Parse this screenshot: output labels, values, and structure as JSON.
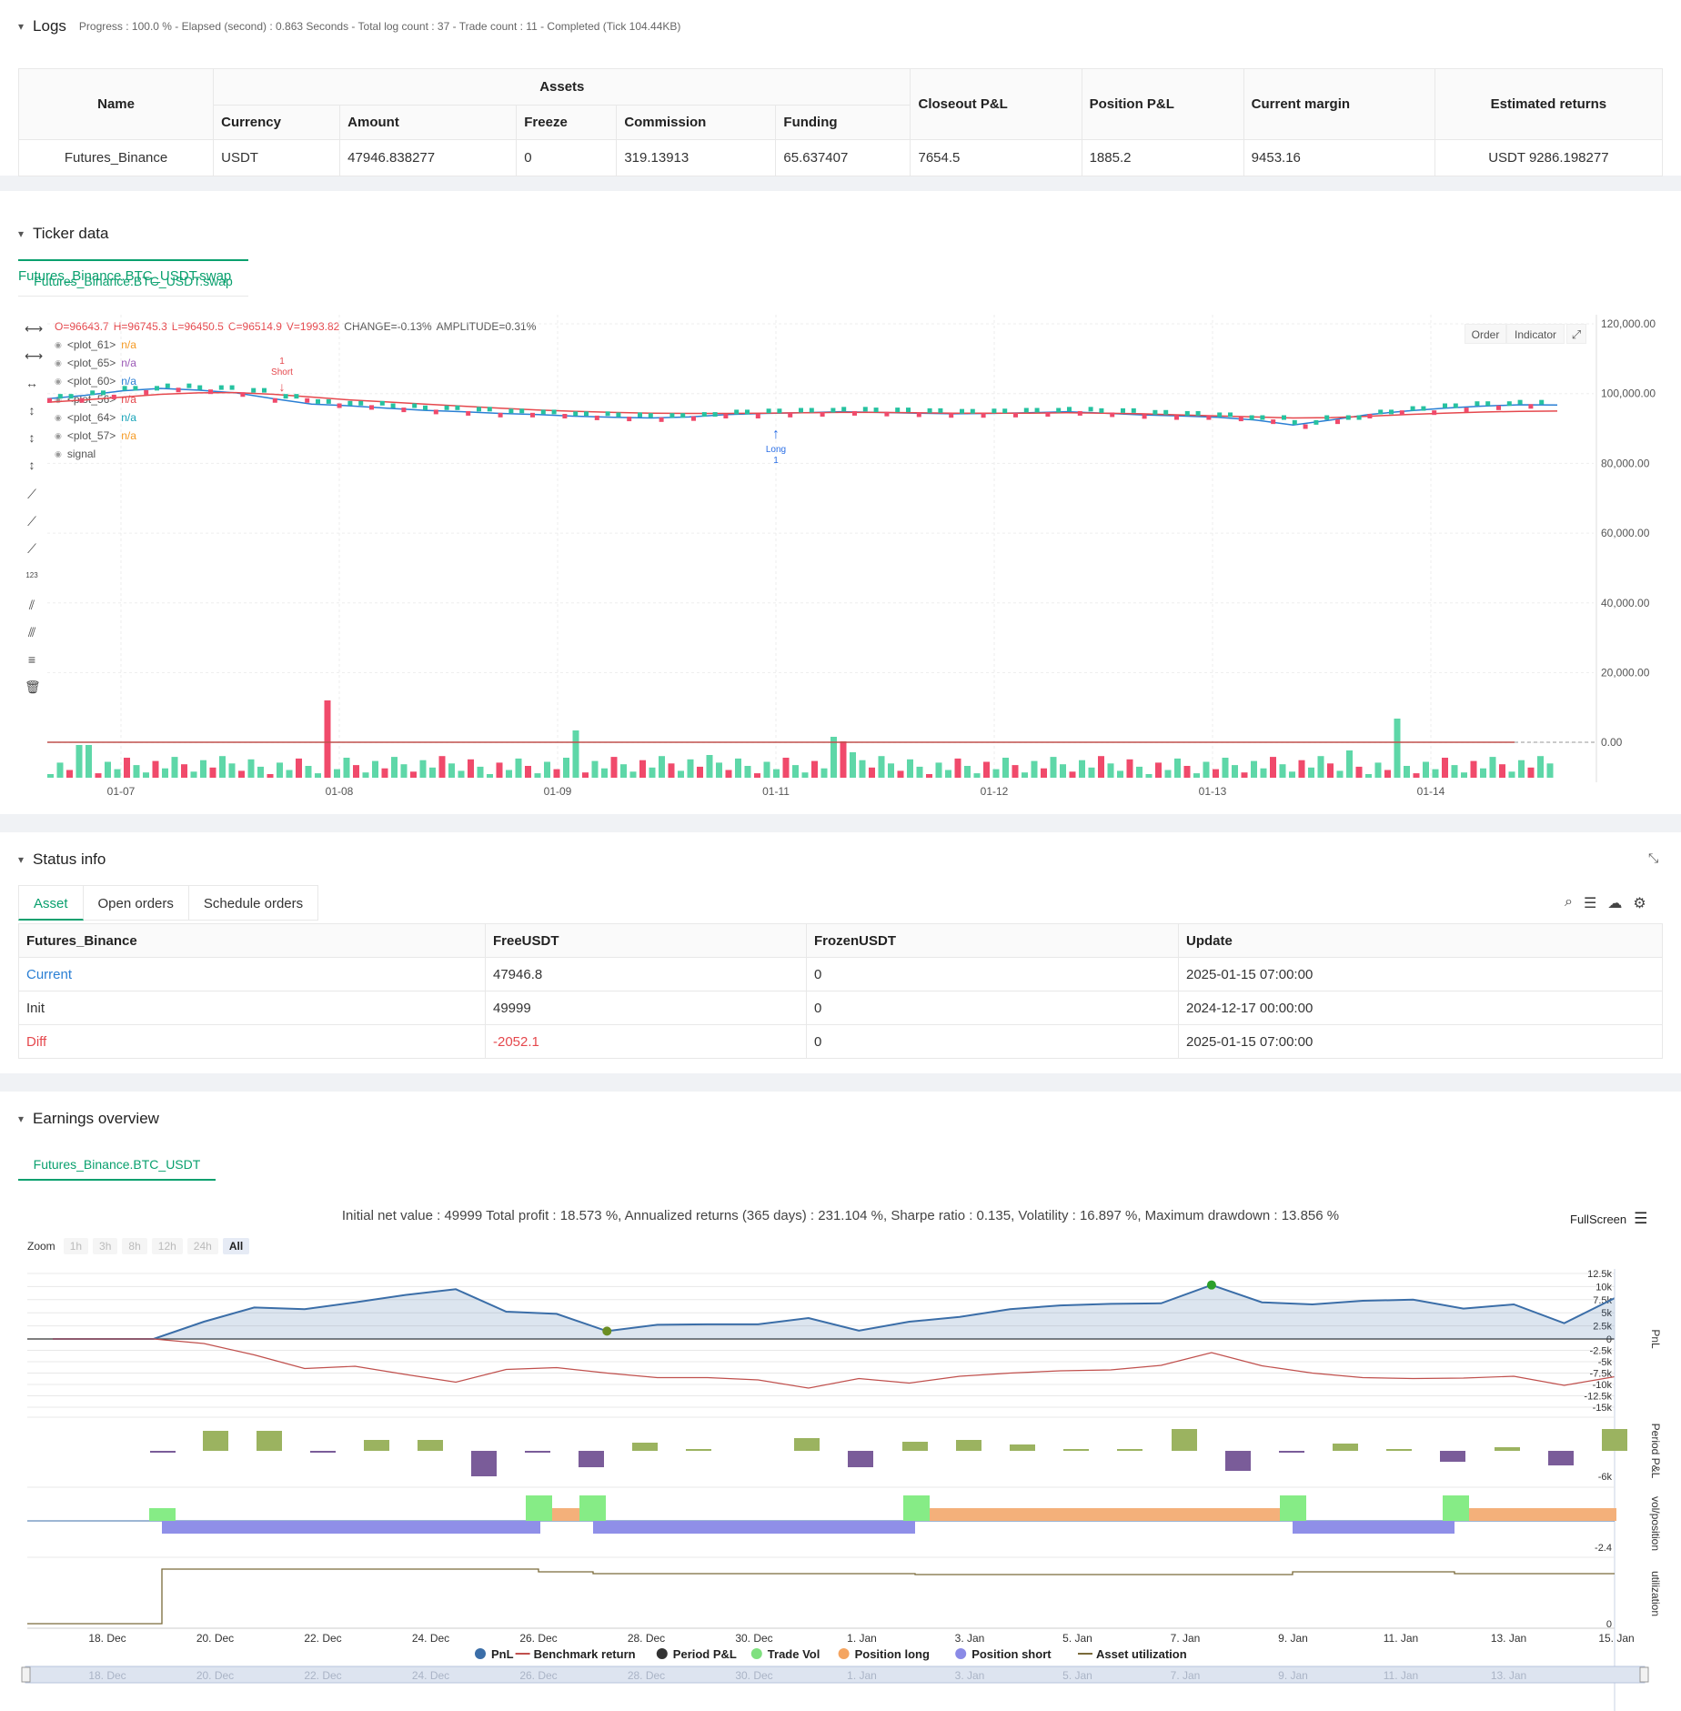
{
  "logs": {
    "title": "Logs",
    "summary": "Progress : 100.0 % - Elapsed (second) : 0.863  Seconds - Total log count : 37 - Trade count : 11 - Completed (Tick 104.44KB)"
  },
  "assets_table": {
    "name_header": "Name",
    "assets_header": "Assets",
    "closeout_header": "Closeout P&L",
    "position_header": "Position P&L",
    "margin_header": "Current margin",
    "returns_header": "Estimated returns",
    "sub_headers": [
      "Currency",
      "Amount",
      "Freeze",
      "Commission",
      "Funding"
    ],
    "row": {
      "name": "Futures_Binance",
      "currency": "USDT",
      "amount": "47946.838277",
      "freeze": "0",
      "commission": "319.13913",
      "funding": "65.637407",
      "closeout": "7654.5",
      "position": "1885.2",
      "margin": "9453.16",
      "returns": "USDT 9286.198277"
    }
  },
  "ticker": {
    "title": "Ticker data",
    "tab": "Futures_Binance.BTC_USDT.swap",
    "ohlc": {
      "o": "O=96643.7",
      "h": "H=96745.3",
      "l": "L=96450.5",
      "c": "C=96514.9",
      "v": "V=1993.82",
      "change": "CHANGE=-0.13%",
      "amp": "AMPLITUDE=0.31%"
    },
    "legend": [
      {
        "name": "<plot_61>",
        "val": "n/a",
        "color": "#f59a23"
      },
      {
        "name": "<plot_65>",
        "val": "n/a",
        "color": "#9b59b6"
      },
      {
        "name": "<plot_60>",
        "val": "n/a",
        "color": "#2a7fd4"
      },
      {
        "name": "<plot_56>",
        "val": "n/a",
        "color": "#e5484d"
      },
      {
        "name": "<plot_64>",
        "val": "n/a",
        "color": "#16a3b8"
      },
      {
        "name": "<plot_57>",
        "val": "n/a",
        "color": "#f59a23"
      },
      {
        "name": "signal",
        "val": "",
        "color": "#555"
      }
    ],
    "buttons": {
      "order": "Order",
      "indicator": "Indicator"
    },
    "yaxis": [
      "120,000.00",
      "100,000.00",
      "80,000.00",
      "60,000.00",
      "40,000.00",
      "20,000.00",
      "0.00"
    ],
    "xaxis": [
      "01-07",
      "01-08",
      "01-09",
      "01-11",
      "01-12",
      "01-13",
      "01-14"
    ],
    "short_label": "Short",
    "short_n": "1",
    "long_label": "Long",
    "long_n": "1"
  },
  "status": {
    "title": "Status info",
    "tabs": [
      "Asset",
      "Open orders",
      "Schedule orders"
    ],
    "headers": [
      "Futures_Binance",
      "FreeUSDT",
      "FrozenUSDT",
      "Update"
    ],
    "rows": [
      {
        "label": "Current",
        "free": "47946.8",
        "frozen": "0",
        "update": "2025-01-15 07:00:00",
        "color": "#2a7fd4"
      },
      {
        "label": "Init",
        "free": "49999",
        "frozen": "0",
        "update": "2024-12-17 00:00:00",
        "color": "#333"
      },
      {
        "label": "Diff",
        "free": "-2052.1",
        "frozen": "0",
        "update": "2025-01-15 07:00:00",
        "color": "#e5484d"
      }
    ]
  },
  "earnings": {
    "title": "Earnings overview",
    "tab": "Futures_Binance.BTC_USDT",
    "summary": "Initial net value : 49999  Total profit : 18.573 %, Annualized returns (365 days) : 231.104 %, Sharpe ratio : 0.135, Volatility : 16.897 %, Maximum drawdown : 13.856 %",
    "fullscreen": "FullScreen",
    "zoom_label": "Zoom",
    "zoom_buttons": [
      "1h",
      "3h",
      "8h",
      "12h",
      "24h",
      "All"
    ],
    "pnl_axis": [
      "12.5k",
      "10k",
      "7.5k",
      "5k",
      "2.5k",
      "0",
      "-2.5k",
      "-5k",
      "-7.5k",
      "-10k",
      "-12.5k",
      "-15k"
    ],
    "period_axis": "-6k",
    "vol_axis": "-2.4",
    "util_axis": "0",
    "side_labels": [
      "PnL",
      "Period P&L",
      "vol/position",
      "utilization"
    ],
    "xaxis": [
      "18. Dec",
      "20. Dec",
      "22. Dec",
      "24. Dec",
      "26. Dec",
      "28. Dec",
      "30. Dec",
      "1. Jan",
      "3. Jan",
      "5. Jan",
      "7. Jan",
      "9. Jan",
      "11. Jan",
      "13. Jan",
      "15. Jan"
    ],
    "nav_axis": [
      "18. Dec",
      "20. Dec",
      "22. Dec",
      "24. Dec",
      "26. Dec",
      "28. Dec",
      "30. Dec",
      "1. Jan",
      "3. Jan",
      "5. Jan",
      "7. Jan",
      "9. Jan",
      "11. Jan",
      "13. Jan"
    ],
    "legend": [
      {
        "name": "PnL",
        "color": "#3b6ea8",
        "type": "dot"
      },
      {
        "name": "Benchmark return",
        "color": "#c0504d",
        "type": "line"
      },
      {
        "name": "Period P&L",
        "color": "#333",
        "type": "dot"
      },
      {
        "name": "Trade Vol",
        "color": "#7fe07f",
        "type": "dot"
      },
      {
        "name": "Position long",
        "color": "#f4a460",
        "type": "dot"
      },
      {
        "name": "Position short",
        "color": "#8a8ae6",
        "type": "dot"
      },
      {
        "name": "Asset utilization",
        "color": "#7a6a3a",
        "type": "line"
      }
    ]
  },
  "chart_data": {
    "type": "line",
    "series": [
      {
        "name": "PnL",
        "values": [
          0,
          0,
          0,
          3300,
          6000,
          5700,
          7000,
          8400,
          9500,
          5200,
          4800,
          1500,
          2700,
          2800,
          2800,
          4000,
          1600,
          3300,
          4200,
          5700,
          6400,
          6700,
          6800,
          10300,
          7000,
          6600,
          7300,
          7500,
          5800,
          6600,
          3000,
          7800
        ]
      },
      {
        "name": "Benchmark return",
        "values": [
          0,
          0,
          0,
          -1000,
          -3500,
          -6500,
          -6000,
          -7800,
          -9500,
          -6700,
          -6300,
          -7500,
          -8500,
          -8500,
          -9000,
          -10800,
          -8700,
          -9700,
          -8200,
          -7500,
          -7000,
          -6800,
          -5800,
          -3000,
          -5900,
          -7500,
          -8500,
          -8700,
          -8600,
          -8200,
          -10200,
          -8300
        ]
      }
    ]
  }
}
